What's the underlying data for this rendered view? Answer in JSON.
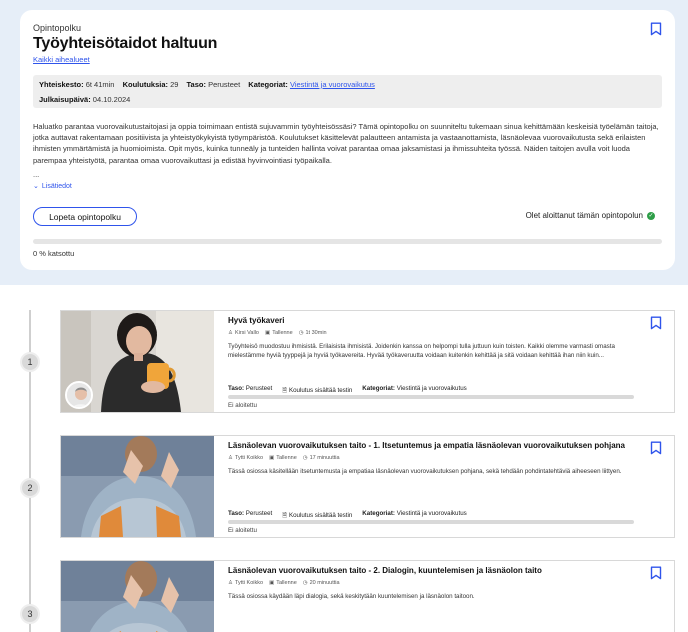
{
  "hero": {
    "eyebrow": "Opintopolku",
    "title": "Työyhteisötaidot haltuun",
    "all_topics_link": "Kaikki aihealueet",
    "meta": {
      "duration_label": "Yhteiskesto:",
      "duration_value": "6t 41min",
      "courses_label": "Koulutuksia:",
      "courses_value": "29",
      "level_label": "Taso:",
      "level_value": "Perusteet",
      "categories_label": "Kategoriat:",
      "categories_value": "Viestintä ja vuorovaikutus",
      "published_label": "Julkaisupäivä:",
      "published_value": "04.10.2024"
    },
    "description": "Haluatko parantaa vuorovaikutustaitojasi ja oppia toimimaan entistä sujuvammin työyhteisössäsi? Tämä opintopolku on suunniteltu tukemaan sinua kehittämään keskeisiä työelämän taitoja, jotka auttavat rakentamaan positiivista ja yhteistyökykyistä työympäristöä. Koulutukset käsittelevät palautteen antamista ja vastaanottamista, läsnäolevaa vuorovaikutusta sekä erilaisten ihmisten ymmärtämistä ja huomioimista. Opit myös, kuinka tunneäly ja tunteiden hallinta voivat parantaa omaa jaksamistasi ja ihmissuhteita työssä. Näiden taitojen avulla voit luoda parempaa yhteistyötä, parantaa omaa vuorovaikuttasi ja edistää hyvinvointiasi työpaikalla.",
    "ellipsis": "...",
    "more_info": "Lisätiedot",
    "stop_button": "Lopeta opintopolku",
    "started_text": "Olet aloittanut tämän opintopolun",
    "progress": 0,
    "progress_text": "0 % katsottu"
  },
  "courses": [
    {
      "step": "1",
      "title": "Hyvä työkaveri",
      "author": "Kirsi Vallo",
      "format": "Tallenne",
      "duration": "1t 30min",
      "description": "Työyhteisö muodostuu ihmisistä. Erilaisista ihmisistä. Joidenkin kanssa on helpompi tulla juttuun kuin toisten. Kaikki olemme varmasti omasta mielestämme hyviä tyyppejä ja hyviä työkavereita. Hyvää työkaveruutta voidaan kuitenkin kehittää ja sitä voidaan kehittää ihan niin kuin...",
      "level_label": "Taso:",
      "level_value": "Perusteet",
      "test_text": "Koulutus sisältää testin",
      "categories_label": "Kategoriat:",
      "categories_value": "Viestintä ja vuorovaikutus",
      "status": "Ei aloitettu"
    },
    {
      "step": "2",
      "title": "Läsnäolevan vuorovaikutuksen taito - 1. Itsetuntemus ja empatia läsnäolevan vuorovaikutuksen pohjana",
      "author": "Tytti Koikko",
      "format": "Tallenne",
      "duration": "17 minuuttia",
      "description": "Tässä osiossa käsitellään itsetuntemusta ja empatiaa läsnäolevan vuorovaikutuksen pohjana, sekä tehdään pohdintatehtäviä aiheeseen liittyen.",
      "level_label": "Taso:",
      "level_value": "Perusteet",
      "test_text": "Koulutus sisältää testin",
      "categories_label": "Kategoriat:",
      "categories_value": "Viestintä ja vuorovaikutus",
      "status": "Ei aloitettu"
    },
    {
      "step": "3",
      "title": "Läsnäolevan vuorovaikutuksen taito - 2. Dialogin, kuuntelemisen ja läsnäolon taito",
      "author": "Tytti Koikko",
      "format": "Tallenne",
      "duration": "20 minuuttia",
      "description": "Tässä osiossa käydään läpi dialogia, sekä keskitytään kuuntelemisen ja läsnäolon taitoon."
    }
  ],
  "colors": {
    "accent": "#2f54eb",
    "success": "#2e9e48",
    "top_band": "#e6eef8"
  }
}
